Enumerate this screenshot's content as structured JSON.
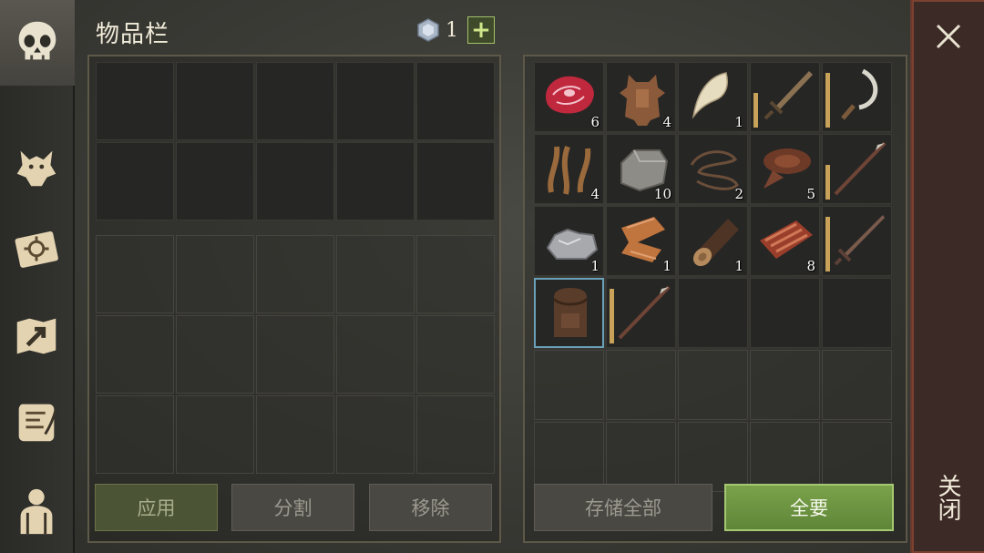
{
  "header": {
    "title": "物品栏",
    "gem_count": "1",
    "add_label": "+"
  },
  "sidebar": {
    "tabs": [
      "skull",
      "wolf",
      "blueprint",
      "map",
      "quest-scroll",
      "character"
    ]
  },
  "stash_items": [
    {
      "name": "raw-meat",
      "qty": "6"
    },
    {
      "name": "hide",
      "qty": "4"
    },
    {
      "name": "fang",
      "qty": "1"
    },
    {
      "name": "sword",
      "qty": ""
    },
    {
      "name": "sickle",
      "qty": ""
    },
    {
      "name": "fiber",
      "qty": "4"
    },
    {
      "name": "stone",
      "qty": "10"
    },
    {
      "name": "rope",
      "qty": "2"
    },
    {
      "name": "leather",
      "qty": "5"
    },
    {
      "name": "spear",
      "qty": ""
    },
    {
      "name": "iron-ore",
      "qty": "1"
    },
    {
      "name": "cloth",
      "qty": "1"
    },
    {
      "name": "log",
      "qty": "1"
    },
    {
      "name": "cooked-meat",
      "qty": "8"
    },
    {
      "name": "sword",
      "qty": ""
    },
    {
      "name": "backpack",
      "qty": ""
    },
    {
      "name": "spear",
      "qty": ""
    }
  ],
  "buttons": {
    "apply": "应用",
    "split": "分割",
    "remove": "移除",
    "store_all": "存储全部",
    "take_all": "全要"
  },
  "close": {
    "label": "关闭"
  },
  "colors": {
    "accent_green": "#6f9a44",
    "close_bg": "#3c2a26",
    "selected_border": "#6aa0b8"
  }
}
